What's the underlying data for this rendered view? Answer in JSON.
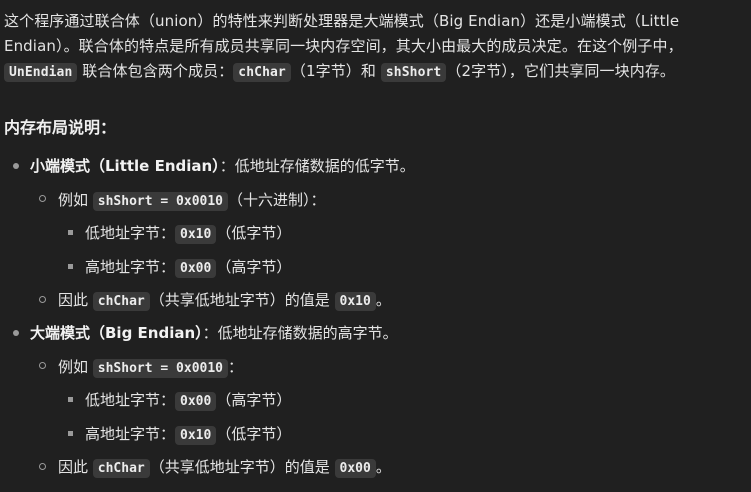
{
  "intro": {
    "t1": "这个程序通过联合体（union）的特性来判断处理器是大端模式（Big Endian）还是小端模式（Little Endian）。联合体的特点是所有成员共享同一块内存空间，其大小由最大的成员决定。在这个例子中，",
    "c1": "UnEndian",
    "t2": " 联合体包含两个成员：",
    "c2": "chChar",
    "t3": "（1字节）和 ",
    "c3": "shShort",
    "t4": "（2字节），它们共享同一块内存。"
  },
  "heading": "内存布局说明：",
  "little": {
    "title": "小端模式（Little Endian）",
    "desc": "：低地址存储数据的低字节。",
    "example_prefix": "例如 ",
    "example_code": "shShort = 0x0010",
    "example_suffix": "（十六进制）：",
    "low_label": "低地址字节：",
    "low_code": "0x10",
    "low_note": "（低字节）",
    "high_label": "高地址字节：",
    "high_code": "0x00",
    "high_note": "（高字节）",
    "result_prefix": "因此 ",
    "result_code": "chChar",
    "result_mid": "（共享低地址字节）的值是 ",
    "result_value": "0x10",
    "result_end": "。"
  },
  "big": {
    "title": "大端模式（Big Endian）",
    "desc": "：低地址存储数据的高字节。",
    "example_prefix": "例如 ",
    "example_code": "shShort = 0x0010",
    "example_suffix": "：",
    "low_label": "低地址字节：",
    "low_code": "0x00",
    "low_note": "（高字节）",
    "high_label": "高地址字节：",
    "high_code": "0x10",
    "high_note": "（低字节）",
    "result_prefix": "因此 ",
    "result_code": "chChar",
    "result_mid": "（共享低地址字节）的值是 ",
    "result_value": "0x00",
    "result_end": "。"
  }
}
